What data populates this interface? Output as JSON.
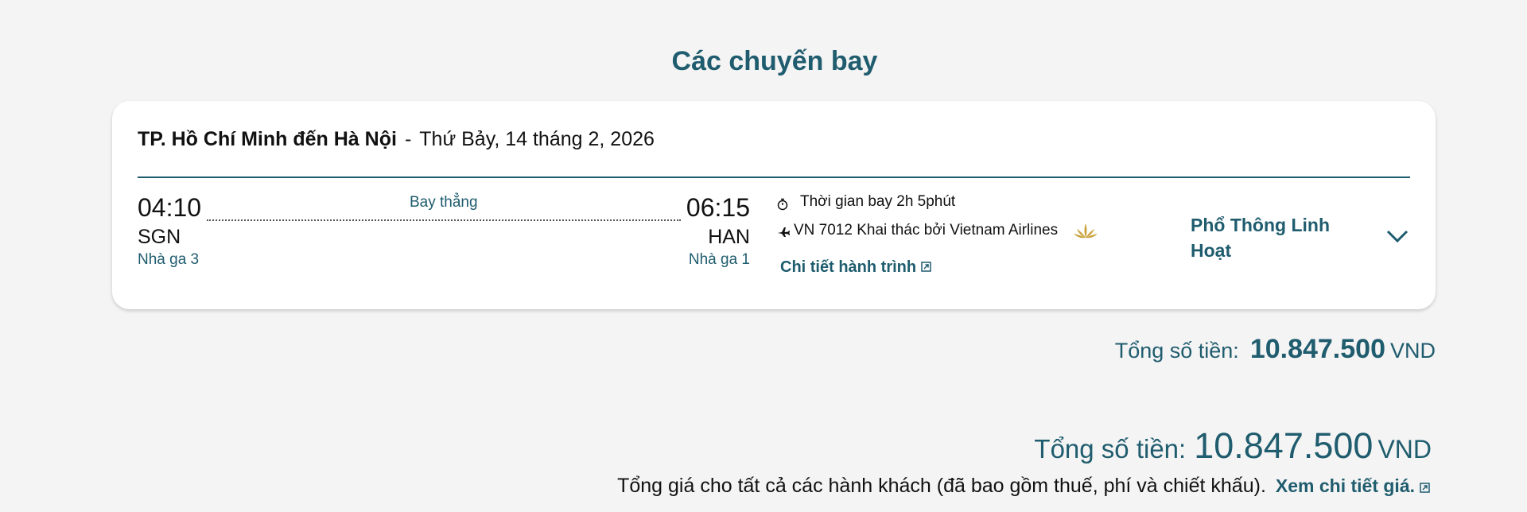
{
  "page": {
    "title": "Các chuyến bay"
  },
  "flight": {
    "route": "TP. Hồ Chí Minh đến Hà Nội",
    "separator": "-",
    "date": "Thứ Bảy, 14 tháng 2, 2026",
    "departure": {
      "time": "04:10",
      "code": "SGN",
      "terminal": "Nhà ga 3"
    },
    "arrival": {
      "time": "06:15",
      "code": "HAN",
      "terminal": "Nhà ga 1"
    },
    "stops": "Bay thẳng",
    "duration": "Thời gian bay 2h 5phút",
    "flight_info": "VN 7012 Khai thác bởi Vietnam Airlines",
    "itinerary_link": "Chi tiết hành trình",
    "fare_class": "Phổ Thông Linh Hoạt"
  },
  "subtotal": {
    "label": "Tổng số tiền:",
    "amount": "10.847.500",
    "currency": "VND"
  },
  "grand_total": {
    "label": "Tổng số tiền:",
    "amount": "10.847.500",
    "currency": "VND",
    "note": "Tổng giá cho tất cả các hành khách (đã bao gồm thuế, phí và chiết khấu).",
    "detail_link": "Xem chi tiết giá."
  },
  "colors": {
    "brand": "#1f5c6e",
    "gold": "#c9a23a",
    "background": "#f4f4f4"
  },
  "icons": [
    "stopwatch-icon",
    "plane-icon",
    "lotus-logo-icon",
    "external-link-icon",
    "chevron-down-icon"
  ]
}
